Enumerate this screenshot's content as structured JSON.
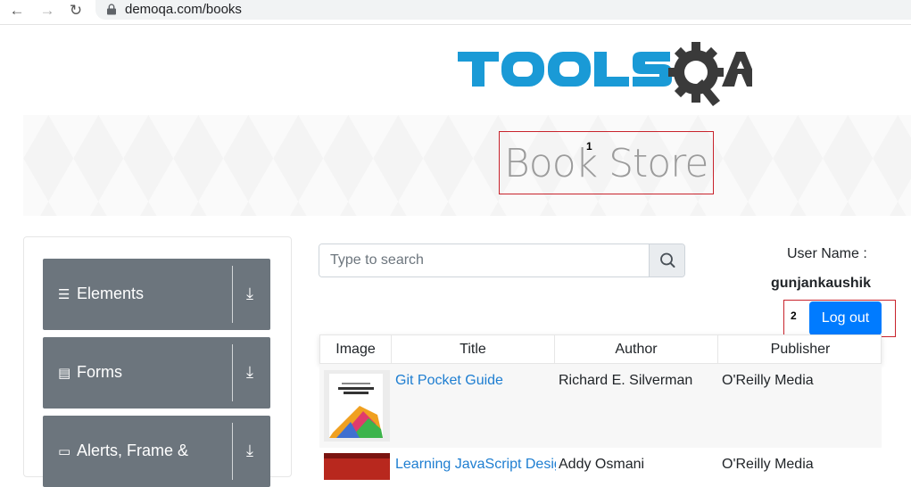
{
  "browser": {
    "url": "demoqa.com/books",
    "back_glyph": "←",
    "forward_glyph": "→",
    "reload_glyph": "↻"
  },
  "banner": {
    "title": "Book Store"
  },
  "annotations": [
    {
      "label": "1"
    },
    {
      "label": "2"
    }
  ],
  "sidebar": {
    "groups": [
      {
        "label": "Elements",
        "icon": "☰"
      },
      {
        "label": "Forms",
        "icon": "▤"
      },
      {
        "label": "Alerts, Frame &",
        "icon": "▭"
      }
    ],
    "download_glyph": "⤓"
  },
  "search": {
    "placeholder": "Type to search"
  },
  "user": {
    "label": "User Name :",
    "name": "gunjankaushik",
    "logout_label": "Log out"
  },
  "table": {
    "columns": [
      "Image",
      "Title",
      "Author",
      "Publisher"
    ],
    "rows": [
      {
        "title": "Git Pocket Guide",
        "author": "Richard E. Silverman",
        "publisher": "O'Reilly Media"
      },
      {
        "title": "Learning JavaScript Design Patterns",
        "author": "Addy Osmani",
        "publisher": "O'Reilly Media"
      }
    ]
  },
  "colors": {
    "primary": "#007bff",
    "sidebar_gray": "#6c757d",
    "logo_blue": "#1a9ad6",
    "logo_dark": "#3a3a3a",
    "annotation_red": "#c8232c",
    "link": "#1e7ed1"
  }
}
